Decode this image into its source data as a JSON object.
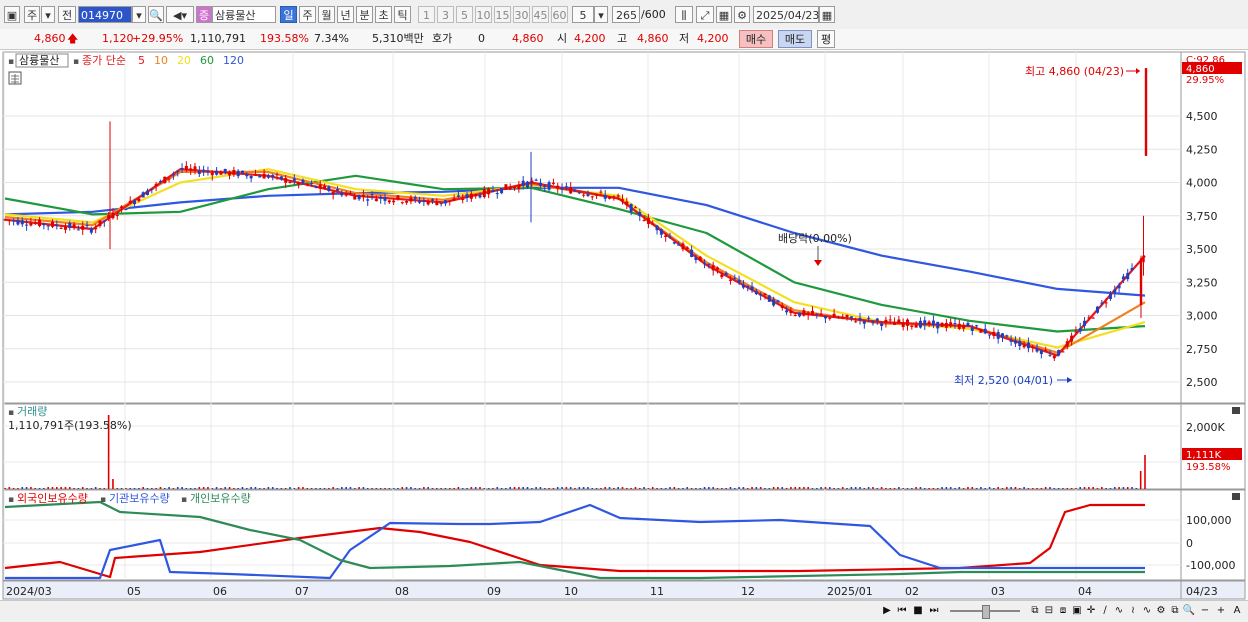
{
  "toolbar": {
    "period_main": "주",
    "prev_label": "전",
    "stock_code": "014970",
    "stock_name": "삼륭물산",
    "badge": "증",
    "period_tabs": [
      "일",
      "주",
      "월",
      "년",
      "분",
      "초",
      "틱"
    ],
    "active_period": "일",
    "intervals": [
      "1",
      "3",
      "5",
      "10",
      "15",
      "30",
      "45",
      "60"
    ],
    "interval_select": "5",
    "count": "265",
    "count_max": "/600",
    "date": "2025/04/23"
  },
  "quote": {
    "price": "4,860",
    "change": "1,120",
    "change_pct": "+29.95%",
    "volume": "1,110,791",
    "volume_ratio": "193.58%",
    "turnover_pct": "7.34%",
    "amount": "5,310백만",
    "hoga_label": "호가",
    "hoga_value": "0",
    "current": "4,860",
    "open_label": "시",
    "open": "4,200",
    "high_label": "고",
    "high": "4,860",
    "low_label": "저",
    "low": "4,200",
    "buy_label": "매수",
    "sell_label": "매도",
    "eval_label": "평"
  },
  "price_panel": {
    "stock_tag": "삼륭물산",
    "ma_title": "종가 단순",
    "ma_periods": [
      "5",
      "10",
      "20",
      "60",
      "120"
    ],
    "ma_colors": [
      "#e31a1c",
      "#f08020",
      "#f2e020",
      "#1e9a3c",
      "#2f57e0"
    ],
    "y_ticks": [
      "4,500",
      "4,250",
      "4,000",
      "3,750",
      "3,500",
      "3,250",
      "3,000",
      "2,750",
      "2,500"
    ],
    "top_label": "C:92.86",
    "current_tag": "4,860",
    "current_pct": "29.95%",
    "high_annotation": "최고 4,860 (04/23)",
    "low_annotation": "최저 2,520 (04/01)",
    "dividend_annotation": "배당락(0.00%)"
  },
  "volume_panel": {
    "title": "거래량",
    "value_label": "1,110,791주(193.58%)",
    "y_tick": "2,000K",
    "current_tag": "1,111K",
    "current_pct": "193.58%"
  },
  "holdings_panel": {
    "legend": [
      "외국인보유수량",
      "기관보유수량",
      "개인보유수량"
    ],
    "legend_colors": [
      "#e00000",
      "#2f57e0",
      "#2e8b57"
    ],
    "y_ticks": [
      "100,000",
      "0",
      "-100,000"
    ]
  },
  "x_axis": {
    "labels": [
      "2024/03",
      "05",
      "06",
      "07",
      "08",
      "09",
      "10",
      "11",
      "12",
      "2025/01",
      "02",
      "03",
      "04"
    ],
    "current_date": "04/23"
  },
  "chart_data": {
    "type": "line",
    "title": "삼륭물산",
    "x": [
      "2024/03",
      "05",
      "06",
      "07",
      "08",
      "09",
      "10",
      "11",
      "12",
      "2025/01",
      "02",
      "03",
      "04",
      "04/23"
    ],
    "series": [
      {
        "name": "5",
        "values": [
          3720,
          3650,
          4100,
          4050,
          3900,
          3850,
          4000,
          3880,
          3380,
          3020,
          2950,
          2920,
          2700,
          3450
        ]
      },
      {
        "name": "10",
        "values": [
          3740,
          3680,
          4080,
          4080,
          3920,
          3870,
          3990,
          3880,
          3400,
          3040,
          2940,
          2920,
          2720,
          3100
        ]
      },
      {
        "name": "20",
        "values": [
          3760,
          3700,
          4000,
          4100,
          3950,
          3900,
          3980,
          3900,
          3450,
          3100,
          2950,
          2900,
          2760,
          2950
        ]
      },
      {
        "name": "60",
        "values": [
          3880,
          3760,
          3780,
          3950,
          4050,
          3950,
          3960,
          3800,
          3620,
          3250,
          3080,
          2960,
          2880,
          2920
        ]
      },
      {
        "name": "120",
        "values": [
          3760,
          3780,
          3850,
          3900,
          3920,
          3930,
          3960,
          3960,
          3830,
          3620,
          3450,
          3330,
          3200,
          3150
        ]
      }
    ],
    "ylim": [
      2400,
      4900
    ],
    "high": 4860,
    "low": 2520
  }
}
